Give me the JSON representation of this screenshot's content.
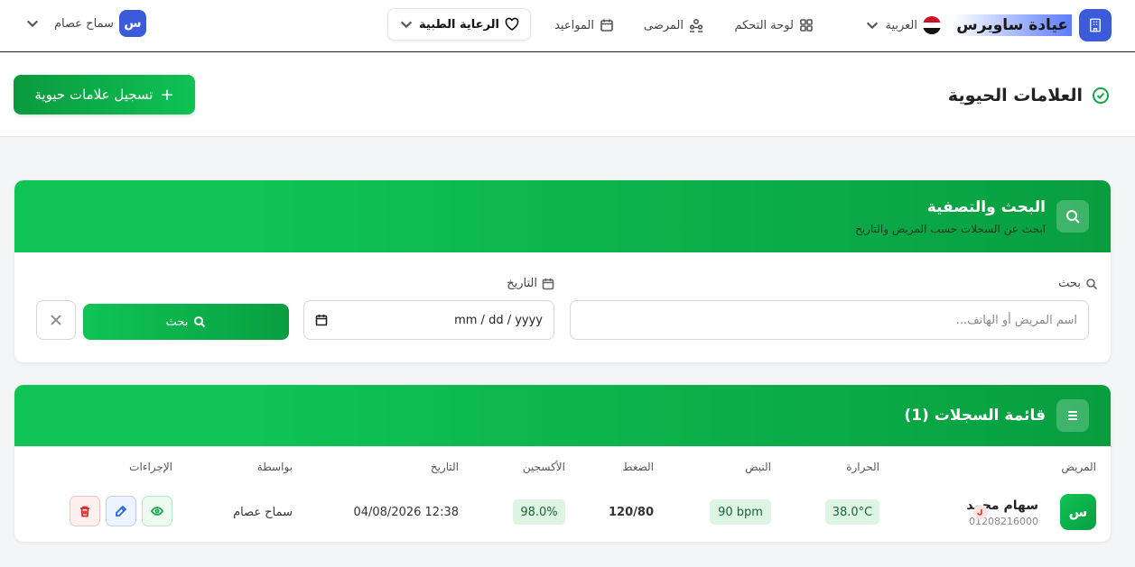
{
  "nav": {
    "brand": "عيادة ساويرس",
    "language": "العربية",
    "dashboard": "لوحة التحكم",
    "patients": "المرضى",
    "appointments": "المواعيد",
    "medical_care": "الرعاية الطبية",
    "user_name": "سماح عصام",
    "user_initial": "س"
  },
  "page": {
    "title": "العلامات الحيوية",
    "add_button": "تسجيل علامات حيوية",
    "add_icon": "+"
  },
  "filter": {
    "title": "البحث والتصفية",
    "subtitle": "ابحث عن السجلات حسب المريض والتاريخ",
    "search_label": "بحث",
    "search_placeholder": "اسم المريض أو الهاتف...",
    "date_label": "التاريخ",
    "date_value": "mm / dd / yyyy",
    "search_button": "بحث"
  },
  "records": {
    "title": "قائمة السجلات (1)",
    "columns": {
      "patient": "المريض",
      "temperature": "الحرارة",
      "pulse": "النبض",
      "pressure": "الضغط",
      "oxygen": "الأكسجين",
      "date": "التاريخ",
      "by": "بواسطة",
      "actions": "الإجراءات"
    },
    "rows": [
      {
        "initial": "س",
        "name": "سهام محمد",
        "phone": "01208216000",
        "temperature": "38.0°C",
        "pulse": "90 bpm",
        "pressure": "120/80",
        "oxygen": "98.0%",
        "date": "04/08/2026 12:38",
        "by": "سماح عصام"
      }
    ]
  },
  "colors": {
    "accent_green": "#0fc255",
    "brand_blue": "#3b5bdb",
    "pill_bg": "#dcf5e3"
  }
}
